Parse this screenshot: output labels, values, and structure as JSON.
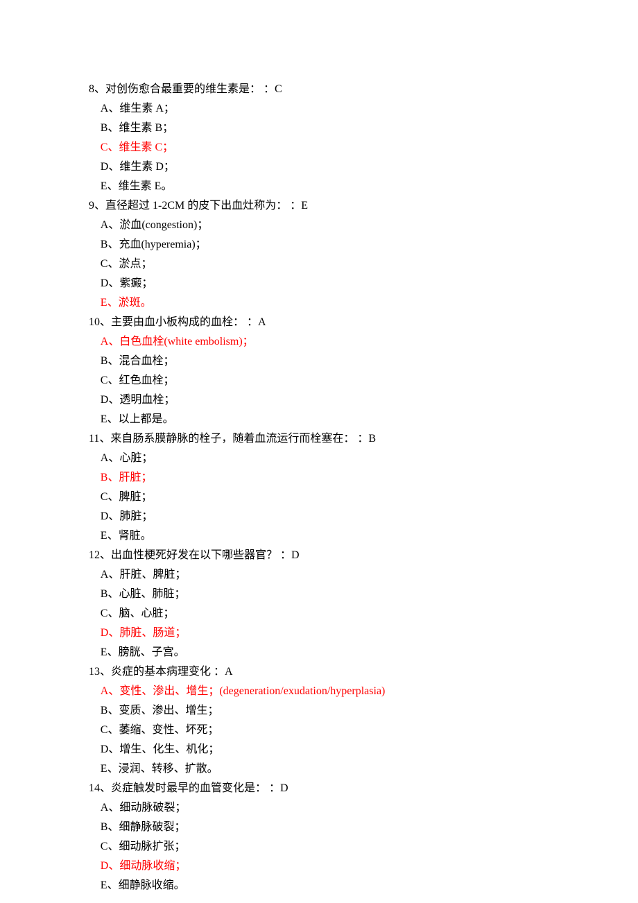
{
  "questions": [
    {
      "stem": "8、对创伤愈合最重要的维生素是： ：C",
      "options": [
        {
          "text": "A、维生素 A；",
          "red": false
        },
        {
          "text": "B、维生素 B；",
          "red": false
        },
        {
          "text": "C、维生素 C；",
          "red": true
        },
        {
          "text": "D、维生素 D；",
          "red": false
        },
        {
          "text": "E、维生素 E。",
          "red": false
        }
      ]
    },
    {
      "stem": "9、直径超过 1-2CM 的皮下出血灶称为： ：E",
      "options": [
        {
          "text": "A、淤血(congestion)；",
          "red": false
        },
        {
          "text": "B、充血(hyperemia)；",
          "red": false
        },
        {
          "text": "C、淤点；",
          "red": false
        },
        {
          "text": "D、紫癜；",
          "red": false
        },
        {
          "text": "E、淤斑。",
          "red": true
        }
      ]
    },
    {
      "stem": "10、主要由血小板构成的血栓： ：A",
      "options": [
        {
          "text": "A、白色血栓(white embolism)；",
          "red": true
        },
        {
          "text": "B、混合血栓；",
          "red": false
        },
        {
          "text": "C、红色血栓；",
          "red": false
        },
        {
          "text": "D、透明血栓；",
          "red": false
        },
        {
          "text": "E、以上都是。",
          "red": false
        }
      ]
    },
    {
      "stem": "11、来自肠系膜静脉的栓子，随着血流运行而栓塞在： ：B",
      "options": [
        {
          "text": "A、心脏；",
          "red": false
        },
        {
          "text": "B、肝脏；",
          "red": true
        },
        {
          "text": "C、脾脏；",
          "red": false
        },
        {
          "text": "D、肺脏；",
          "red": false
        },
        {
          "text": "E、肾脏。",
          "red": false
        }
      ]
    },
    {
      "stem": "12、出血性梗死好发在以下哪些器官？ ：D",
      "options": [
        {
          "text": "A、肝脏、脾脏；",
          "red": false
        },
        {
          "text": "B、心脏、肺脏；",
          "red": false
        },
        {
          "text": "C、脑、心脏；",
          "red": false
        },
        {
          "text": "D、肺脏、肠道；",
          "red": true
        },
        {
          "text": "E、膀胱、子宫。",
          "red": false
        }
      ]
    },
    {
      "stem": "13、炎症的基本病理变化 ：A",
      "options": [
        {
          "text": "A、变性、渗出、增生；(degeneration/exudation/hyperplasia)",
          "red": true
        },
        {
          "text": "B、变质、渗出、增生；",
          "red": false
        },
        {
          "text": "C、萎缩、变性、坏死；",
          "red": false
        },
        {
          "text": "D、增生、化生、机化；",
          "red": false
        },
        {
          "text": "E、浸润、转移、扩散。",
          "red": false
        }
      ]
    },
    {
      "stem": "14、炎症触发时最早的血管变化是： ：D",
      "options": [
        {
          "text": "A、细动脉破裂；",
          "red": false
        },
        {
          "text": "B、细静脉破裂；",
          "red": false
        },
        {
          "text": "C、细动脉扩张；",
          "red": false
        },
        {
          "text": "D、细动脉收缩；",
          "red": true
        },
        {
          "text": "E、细静脉收缩。",
          "red": false
        }
      ]
    }
  ]
}
